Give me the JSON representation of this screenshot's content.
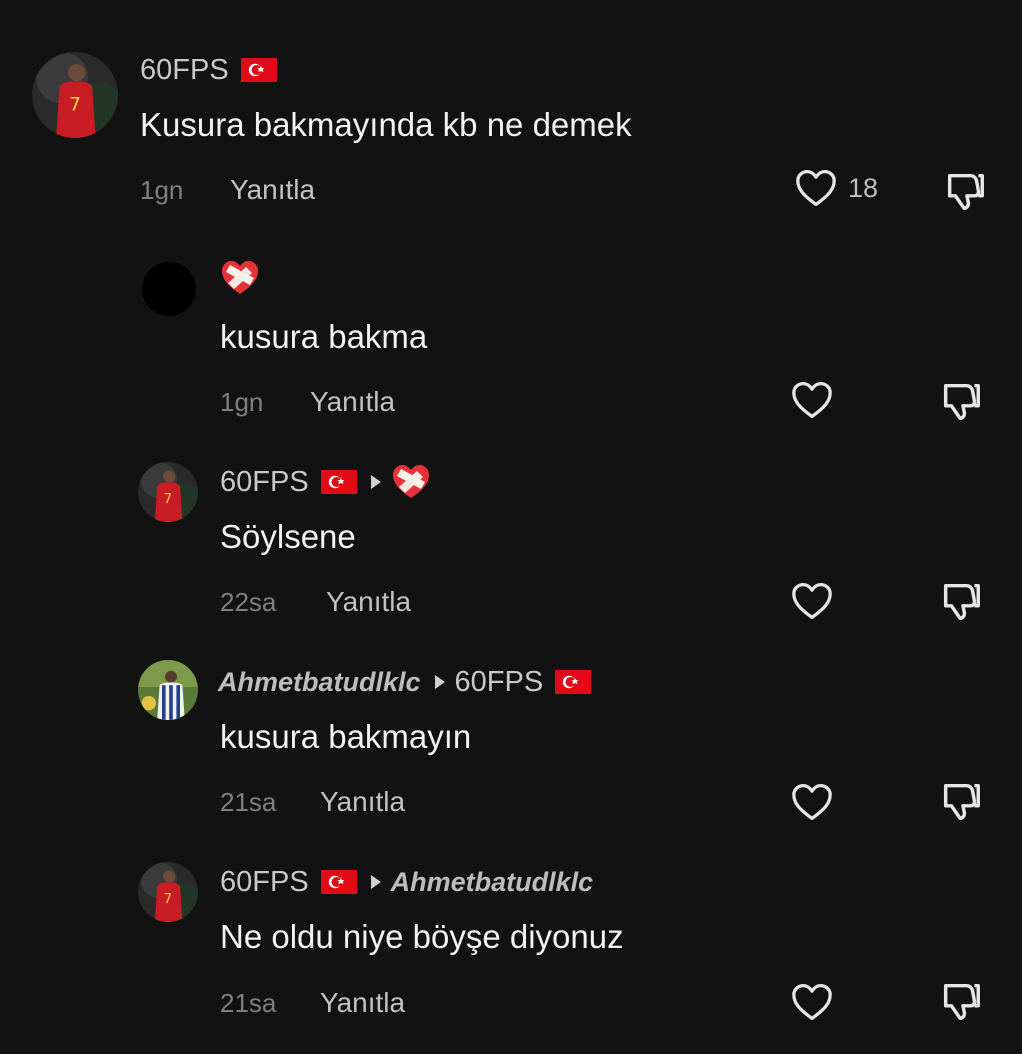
{
  "comments": [
    {
      "user": "60FPS",
      "text": "Kusura bakmayında kb ne demek",
      "time": "1gn",
      "reply_label": "Yanıtla",
      "likes": "18",
      "avatar": "red-jersey-7-player",
      "flag": "turkey-flag-icon"
    },
    {
      "user": "",
      "user_emoji": "mending-heart-icon",
      "text": "kusura bakma",
      "time": "1gn",
      "reply_label": "Yanıtla",
      "avatar": "black-circle"
    },
    {
      "user": "60FPS",
      "reply_to_emoji": "mending-heart-icon",
      "text": "Söylsene",
      "time": "22sa",
      "reply_label": "Yanıtla",
      "avatar": "red-jersey-7-player",
      "flag": "turkey-flag-icon"
    },
    {
      "user": "Ahmetbatudlklc",
      "reply_to": "60FPS",
      "text": "kusura bakmayın",
      "time": "21sa",
      "reply_label": "Yanıtla",
      "avatar": "striped-jersey-player",
      "flag": "turkey-flag-icon"
    },
    {
      "user": "60FPS",
      "reply_to": "Ahmetbatudlklc",
      "text": "Ne oldu niye böyşe diyonuz",
      "time": "21sa",
      "reply_label": "Yanıtla",
      "avatar": "red-jersey-7-player",
      "flag": "turkey-flag-icon"
    }
  ],
  "colors": {
    "background": "#121212",
    "text": "#f2f2f2",
    "muted": "#7f7f7f",
    "flag_red": "#e30a17"
  }
}
